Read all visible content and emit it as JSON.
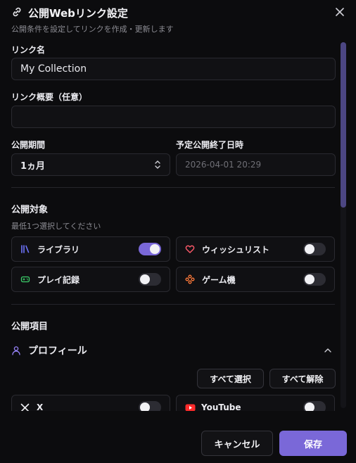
{
  "dialog": {
    "title": "公開Webリンク設定",
    "subtitle": "公開条件を設定してリンクを作成・更新します",
    "close_icon": "close-icon"
  },
  "form": {
    "link_name_label": "リンク名",
    "link_name_value": "My Collection",
    "link_summary_label": "リンク概要（任意）",
    "link_summary_value": "",
    "period_label": "公開期間",
    "period_value": "1ヵ月",
    "end_label": "予定公開終了日時",
    "end_value": "2026-04-01 20:29"
  },
  "targets": {
    "title": "公開対象",
    "hint": "最低1つ選択してください",
    "items": [
      {
        "label": "ライブラリ",
        "icon": "library-icon",
        "color": "#6f74ff",
        "enabled": true
      },
      {
        "label": "ウィッシュリスト",
        "icon": "heart-icon",
        "color": "#ff5a6a",
        "enabled": false
      },
      {
        "label": "プレイ記録",
        "icon": "gamepad-icon",
        "color": "#3ccf6a",
        "enabled": false
      },
      {
        "label": "ゲーム機",
        "icon": "console-icon",
        "color": "#ff7a3a",
        "enabled": false
      }
    ]
  },
  "items": {
    "title": "公開項目",
    "profile_label": "プロフィール",
    "select_all": "すべて選択",
    "deselect_all": "すべて解除",
    "links": [
      {
        "label": "X",
        "icon": "x-logo-icon",
        "enabled": false
      },
      {
        "label": "YouTube",
        "icon": "youtube-icon",
        "enabled": false
      }
    ]
  },
  "footer": {
    "cancel": "キャンセル",
    "save": "保存"
  },
  "colors": {
    "accent": "#7a68d8",
    "background": "#0c0c0e"
  }
}
